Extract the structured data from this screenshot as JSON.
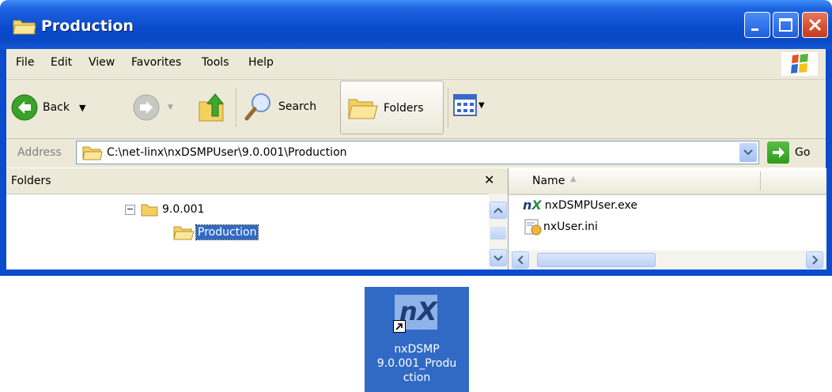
{
  "window": {
    "title": "Production",
    "menu": [
      "File",
      "Edit",
      "View",
      "Favorites",
      "Tools",
      "Help"
    ],
    "toolbar": {
      "back_label": "Back",
      "search_label": "Search",
      "folders_label": "Folders"
    },
    "address": {
      "label": "Address",
      "value": "C:\\net-linx\\nxDSMPUser\\9.0.001\\Production",
      "go_label": "Go"
    },
    "folders_pane": {
      "header": "Folders",
      "close_glyph": "✕",
      "tree": [
        {
          "label": "9.0.001",
          "expander": "⊟"
        },
        {
          "label": "Production"
        }
      ]
    },
    "files_pane": {
      "column_name": "Name",
      "files": [
        {
          "name": "nxDSMPUser.exe",
          "icon": "nx-exe-icon"
        },
        {
          "name": "nxUser.ini",
          "icon": "ini-file-icon"
        }
      ]
    }
  },
  "desktop": {
    "shortcut_label": "nxDSMP\n9.0.001_Produ\nction",
    "shortcut_icon_text": "nX"
  },
  "colors": {
    "title_blue": "#0a4ccd",
    "chrome": "#ece9d8",
    "selection": "#316ac5"
  }
}
